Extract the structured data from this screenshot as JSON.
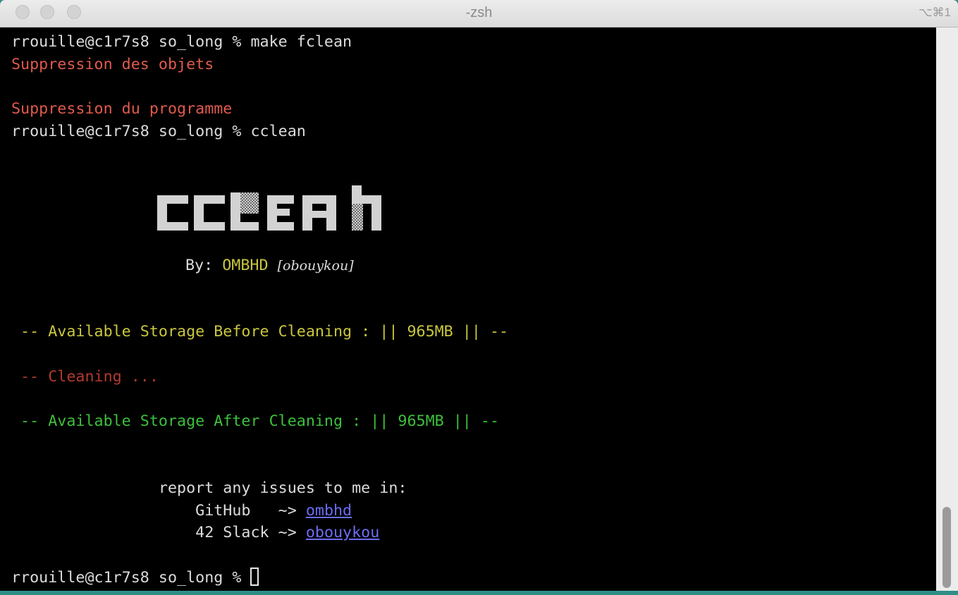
{
  "window": {
    "title": "-zsh",
    "shortcut": "⌥⌘1"
  },
  "terminal": {
    "lines": {
      "l1": "rrouille@c1r7s8 so_long % make fclean",
      "l2": "Suppression des objets",
      "l3": "Suppression du programme",
      "l4": "rrouille@c1r7s8 so_long % cclean",
      "by_label": "By: ",
      "by_author": "OMBHD",
      "by_handle": "[obouykou]",
      "before": " -- Available Storage Before Cleaning : || 965MB || --",
      "cleaning": " -- Cleaning ...",
      "after": " -- Available Storage After Cleaning : || 965MB || --",
      "report": "                report any issues to me in:",
      "github_label": "                    GitHub   ~> ",
      "github_link": "ombhd",
      "slack_label": "                    42 Slack ~> ",
      "slack_link": "obouykou",
      "prompt": "rrouille@c1r7s8 so_long % "
    },
    "logo_text": "CCLEAN"
  },
  "colors": {
    "terminal_bg": "#000000",
    "text": "#dcdcdc",
    "red": "#e05a4d",
    "olive": "#c9c73e",
    "green": "#3cc03c",
    "link": "#6c6cf5"
  }
}
